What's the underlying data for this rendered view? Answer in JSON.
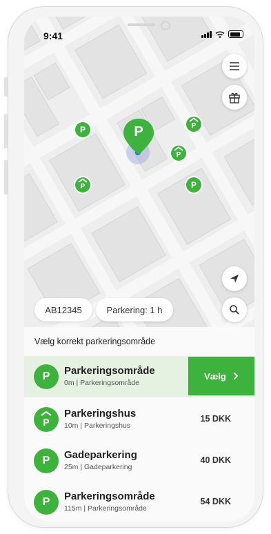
{
  "status_bar": {
    "time": "9:41"
  },
  "map": {
    "pins": [
      {
        "symbol": "P"
      },
      {
        "symbol": "P"
      },
      {
        "symbol": "P"
      },
      {
        "symbol": "P"
      },
      {
        "symbol": "P"
      }
    ],
    "selected_pin": {
      "symbol": "P"
    },
    "icons": {
      "menu": "menu-icon",
      "gift": "gift-icon",
      "locate": "navigation-arrow-icon",
      "search": "search-icon"
    }
  },
  "chips": {
    "plate": "AB12345",
    "duration": "Parkering: 1 h"
  },
  "sheet": {
    "title": "Vælg korrekt parkeringsområde",
    "select_label": "Vælg",
    "items": [
      {
        "name": "Parkeringsområde",
        "sub": "0m | Parkeringsområde",
        "icon": "P",
        "price": ""
      },
      {
        "name": "Parkeringshus",
        "sub": "10m | Parkeringshus",
        "icon": "P",
        "price": "15 DKK"
      },
      {
        "name": "Gadeparkering",
        "sub": "25m | Gadeparkering",
        "icon": "P",
        "price": "40 DKK"
      },
      {
        "name": "Parkeringsområde",
        "sub": "115m | Parkeringsområde",
        "icon": "P",
        "price": "54 DKK"
      }
    ]
  },
  "colors": {
    "accent": "#3db33d",
    "selected_row": "#e6f2e1"
  }
}
